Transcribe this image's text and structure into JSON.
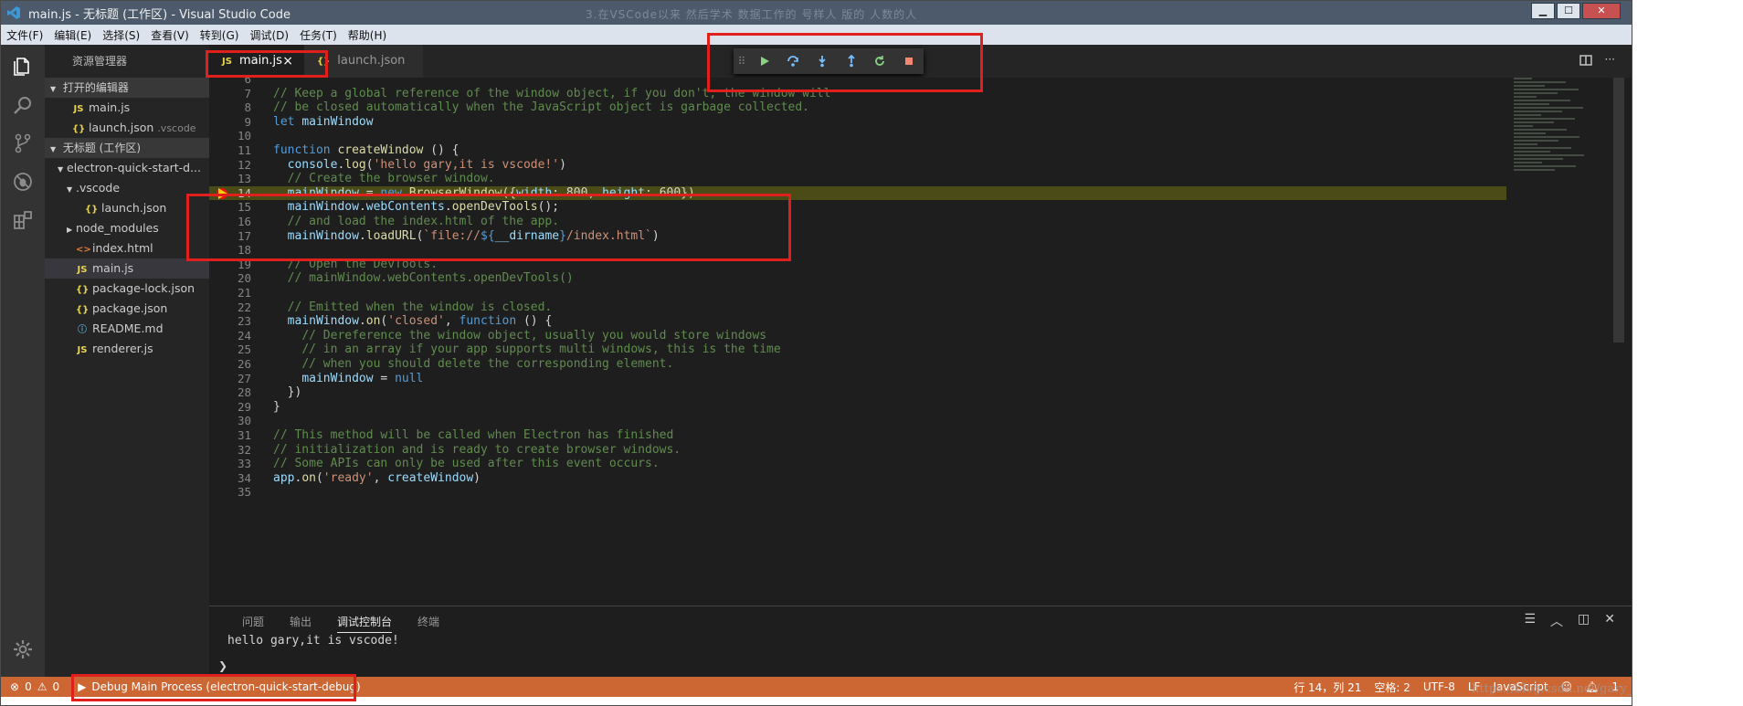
{
  "titlebar": {
    "title": "main.js - 无标题 (工作区) - Visual Studio Code",
    "blurred_caption": "3.在VSCode以来 然后学术 数据工作的 号样人 版的 人数的人"
  },
  "menu": [
    "文件(F)",
    "编辑(E)",
    "选择(S)",
    "查看(V)",
    "转到(G)",
    "调试(D)",
    "任务(T)",
    "帮助(H)"
  ],
  "activity": [
    "files-icon",
    "search-icon",
    "source-control-icon",
    "debug-icon",
    "extensions-icon",
    "settings-gear-icon"
  ],
  "sidebar": {
    "header": "资源管理器",
    "open_editors_title": "打开的编辑器",
    "open_editors": [
      {
        "icon": "JS",
        "name": "main.js",
        "extra": ""
      },
      {
        "icon": "{}",
        "name": "launch.json",
        "extra": ".vscode"
      }
    ],
    "workspace_title": "无标题 (工作区)",
    "tree": [
      {
        "indent": 1,
        "twisty": "▼",
        "icon": "",
        "name": "electron-quick-start-d...",
        "sel": false
      },
      {
        "indent": 2,
        "twisty": "▼",
        "icon": "",
        "name": ".vscode",
        "sel": false
      },
      {
        "indent": 3,
        "twisty": "",
        "icon": "{}",
        "name": "launch.json",
        "sel": false
      },
      {
        "indent": 2,
        "twisty": "▶",
        "icon": "",
        "name": "node_modules",
        "sel": false
      },
      {
        "indent": 2,
        "twisty": "",
        "icon": "<>",
        "name": "index.html",
        "sel": false
      },
      {
        "indent": 2,
        "twisty": "",
        "icon": "JS",
        "name": "main.js",
        "sel": true
      },
      {
        "indent": 2,
        "twisty": "",
        "icon": "{}",
        "name": "package-lock.json",
        "sel": false
      },
      {
        "indent": 2,
        "twisty": "",
        "icon": "{}",
        "name": "package.json",
        "sel": false
      },
      {
        "indent": 2,
        "twisty": "",
        "icon": "ⓘ",
        "name": "README.md",
        "sel": false
      },
      {
        "indent": 2,
        "twisty": "",
        "icon": "JS",
        "name": "renderer.js",
        "sel": false
      }
    ]
  },
  "tabs": [
    {
      "icon": "JS",
      "label": "main.js",
      "close": "×",
      "active": true
    },
    {
      "icon": "{}",
      "label": "launch.json",
      "close": "",
      "active": false
    }
  ],
  "debug_toolbar": [
    "drag-grip-icon",
    "continue-icon",
    "step-over-icon",
    "step-into-icon",
    "step-out-icon",
    "restart-icon",
    "stop-icon"
  ],
  "editor": {
    "current_line": 14,
    "lines": [
      {
        "n": "6",
        "tokens": []
      },
      {
        "n": "7",
        "tokens": [
          [
            "cm",
            "// Keep a global reference of the window object, if you don't, the window will"
          ]
        ]
      },
      {
        "n": "8",
        "tokens": [
          [
            "cm",
            "// be closed automatically when the JavaScript object is garbage collected."
          ]
        ]
      },
      {
        "n": "9",
        "tokens": [
          [
            "kw",
            "let"
          ],
          [
            "pl",
            " "
          ],
          [
            "vr",
            "mainWindow"
          ]
        ]
      },
      {
        "n": "10",
        "tokens": []
      },
      {
        "n": "11",
        "tokens": [
          [
            "kw",
            "function"
          ],
          [
            "pl",
            " "
          ],
          [
            "fn",
            "createWindow"
          ],
          [
            "pl",
            " () {"
          ]
        ]
      },
      {
        "n": "12",
        "tokens": [
          [
            "pl",
            "  "
          ],
          [
            "vr",
            "console"
          ],
          [
            "pl",
            "."
          ],
          [
            "fn",
            "log"
          ],
          [
            "pl",
            "("
          ],
          [
            "str",
            "'hello gary,it is vscode!'"
          ],
          [
            "pl",
            ")"
          ]
        ]
      },
      {
        "n": "13",
        "tokens": [
          [
            "pl",
            "  "
          ],
          [
            "cm",
            "// Create the browser window."
          ]
        ]
      },
      {
        "n": "14",
        "tokens": [
          [
            "pl",
            "  "
          ],
          [
            "vr",
            "mainWindow"
          ],
          [
            "pl",
            " = "
          ],
          [
            "kw",
            "new"
          ],
          [
            "pl",
            " "
          ],
          [
            "fn",
            "BrowserWindow"
          ],
          [
            "pl",
            "({"
          ],
          [
            "vr",
            "width"
          ],
          [
            "pl",
            ": 800, "
          ],
          [
            "vr",
            "height"
          ],
          [
            "pl",
            ": 600})"
          ]
        ]
      },
      {
        "n": "15",
        "tokens": [
          [
            "pl",
            "  "
          ],
          [
            "vr",
            "mainWindow"
          ],
          [
            "pl",
            "."
          ],
          [
            "vr",
            "webContents"
          ],
          [
            "pl",
            "."
          ],
          [
            "fn",
            "openDevTools"
          ],
          [
            "pl",
            "();"
          ]
        ]
      },
      {
        "n": "16",
        "tokens": [
          [
            "pl",
            "  "
          ],
          [
            "cm",
            "// and load the index.html of the app."
          ]
        ]
      },
      {
        "n": "17",
        "tokens": [
          [
            "pl",
            "  "
          ],
          [
            "vr",
            "mainWindow"
          ],
          [
            "pl",
            "."
          ],
          [
            "fn",
            "loadURL"
          ],
          [
            "pl",
            "("
          ],
          [
            "str",
            "`file://"
          ],
          [
            "kw",
            "${"
          ],
          [
            "vr",
            "__dirname"
          ],
          [
            "kw",
            "}"
          ],
          [
            "str",
            "/index.html`"
          ],
          [
            "pl",
            ")"
          ]
        ]
      },
      {
        "n": "18",
        "tokens": []
      },
      {
        "n": "19",
        "tokens": [
          [
            "pl",
            "  "
          ],
          [
            "cm",
            "// Open the DevTools."
          ]
        ]
      },
      {
        "n": "20",
        "tokens": [
          [
            "pl",
            "  "
          ],
          [
            "cm",
            "// mainWindow.webContents.openDevTools()"
          ]
        ]
      },
      {
        "n": "21",
        "tokens": []
      },
      {
        "n": "22",
        "tokens": [
          [
            "pl",
            "  "
          ],
          [
            "cm",
            "// Emitted when the window is closed."
          ]
        ]
      },
      {
        "n": "23",
        "tokens": [
          [
            "pl",
            "  "
          ],
          [
            "vr",
            "mainWindow"
          ],
          [
            "pl",
            "."
          ],
          [
            "fn",
            "on"
          ],
          [
            "pl",
            "("
          ],
          [
            "str",
            "'closed'"
          ],
          [
            "pl",
            ", "
          ],
          [
            "kw",
            "function"
          ],
          [
            "pl",
            " () {"
          ]
        ]
      },
      {
        "n": "24",
        "tokens": [
          [
            "pl",
            "    "
          ],
          [
            "cm",
            "// Dereference the window object, usually you would store windows"
          ]
        ]
      },
      {
        "n": "25",
        "tokens": [
          [
            "pl",
            "    "
          ],
          [
            "cm",
            "// in an array if your app supports multi windows, this is the time"
          ]
        ]
      },
      {
        "n": "26",
        "tokens": [
          [
            "pl",
            "    "
          ],
          [
            "cm",
            "// when you should delete the corresponding element."
          ]
        ]
      },
      {
        "n": "27",
        "tokens": [
          [
            "pl",
            "    "
          ],
          [
            "vr",
            "mainWindow"
          ],
          [
            "pl",
            " = "
          ],
          [
            "kw",
            "null"
          ]
        ]
      },
      {
        "n": "28",
        "tokens": [
          [
            "pl",
            "  })"
          ]
        ]
      },
      {
        "n": "29",
        "tokens": [
          [
            "pl",
            "}"
          ]
        ]
      },
      {
        "n": "30",
        "tokens": []
      },
      {
        "n": "31",
        "tokens": [
          [
            "cm",
            "// This method will be called when Electron has finished"
          ]
        ]
      },
      {
        "n": "32",
        "tokens": [
          [
            "cm",
            "// initialization and is ready to create browser windows."
          ]
        ]
      },
      {
        "n": "33",
        "tokens": [
          [
            "cm",
            "// Some APIs can only be used after this event occurs."
          ]
        ]
      },
      {
        "n": "34",
        "tokens": [
          [
            "vr",
            "app"
          ],
          [
            "pl",
            "."
          ],
          [
            "fn",
            "on"
          ],
          [
            "pl",
            "("
          ],
          [
            "str",
            "'ready'"
          ],
          [
            "pl",
            ", "
          ],
          [
            "vr",
            "createWindow"
          ],
          [
            "pl",
            ")"
          ]
        ]
      },
      {
        "n": "35",
        "tokens": []
      }
    ]
  },
  "panel": {
    "tabs": [
      "问题",
      "输出",
      "调试控制台",
      "终端"
    ],
    "active_tab": "调试控制台",
    "output": "hello gary,it is vscode!",
    "prompt": "❯"
  },
  "statusbar": {
    "errors": "0",
    "warnings": "0",
    "debug_label": "Debug Main Process (electron-quick-start-debug)",
    "position": "行 14，列 21",
    "spaces": "空格: 2",
    "encoding": "UTF-8",
    "eol": "LF",
    "language": "JavaScript",
    "notifications": "1"
  },
  "watermark": "https://blog.csdn.net/gary_yan",
  "colors": {
    "statusbar": "#cc6633",
    "highlight_box": "#e0201c",
    "current_line": "#4b4b18"
  }
}
